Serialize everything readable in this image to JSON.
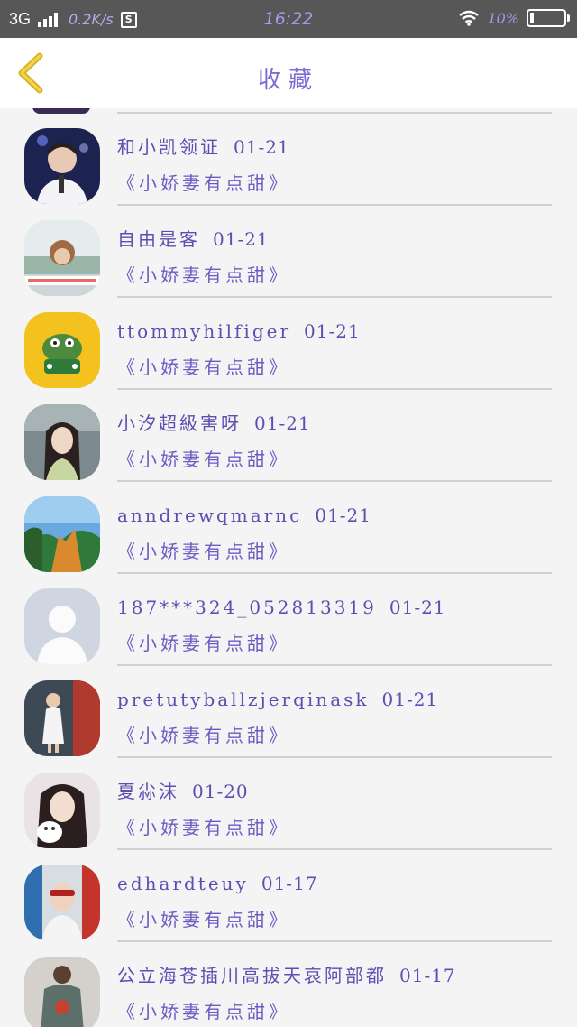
{
  "status_bar": {
    "network": "3G",
    "speed": "0.2K/s",
    "time": "16:22",
    "battery": "10%"
  },
  "header": {
    "title": "收藏"
  },
  "favorites": [
    {
      "user": "和小凯领证",
      "date": "01-21",
      "book": "《小娇妻有点甜》"
    },
    {
      "user": "自由是客",
      "date": "01-21",
      "book": "《小娇妻有点甜》"
    },
    {
      "user": "ttommyhilfiger",
      "date": "01-21",
      "book": "《小娇妻有点甜》"
    },
    {
      "user": "小汐超級害呀",
      "date": "01-21",
      "book": "《小娇妻有点甜》"
    },
    {
      "user": "anndrewqmarnc",
      "date": "01-21",
      "book": "《小娇妻有点甜》"
    },
    {
      "user": "187***324_052813319",
      "date": "01-21",
      "book": "《小娇妻有点甜》"
    },
    {
      "user": "pretutyballzjerqinask",
      "date": "01-21",
      "book": "《小娇妻有点甜》"
    },
    {
      "user": "夏尛沫",
      "date": "01-20",
      "book": "《小娇妻有点甜》"
    },
    {
      "user": "edhardteuy",
      "date": "01-17",
      "book": "《小娇妻有点甜》"
    },
    {
      "user": "公立海苍插川高拔天哀阿部都",
      "date": "01-17",
      "book": "《小娇妻有点甜》"
    }
  ],
  "colors": {
    "accent": "#6b5cc4",
    "back_arrow": "#e6c12a",
    "status_bar": "#575757"
  }
}
